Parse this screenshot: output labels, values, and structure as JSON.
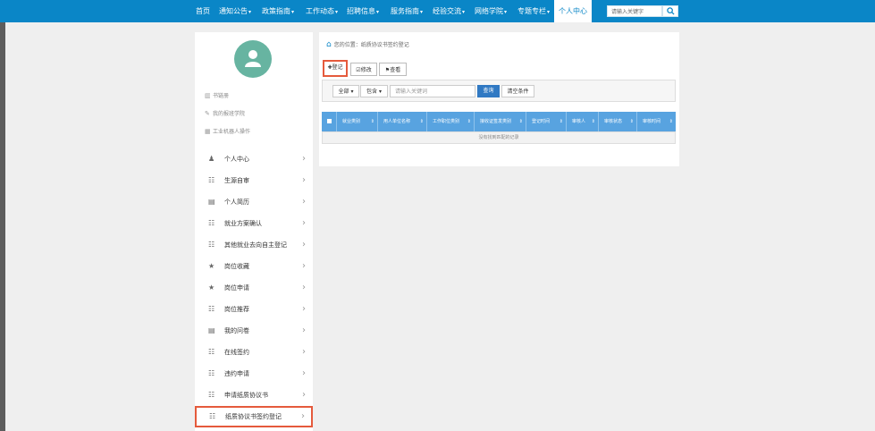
{
  "topnav": {
    "items": [
      "首页",
      "通知公告",
      "政策指南",
      "工作动态",
      "招聘信息",
      "服务指南",
      "经验交流",
      "网络学院",
      "专题专栏",
      "个人中心"
    ],
    "active": "个人中心",
    "search_placeholder": "请输入关键字"
  },
  "sidebar": {
    "quick_links": [
      "书链册",
      "我的报班学院",
      "工业机器人操作"
    ],
    "menu": [
      {
        "label": "个人中心",
        "icon": "person-icon"
      },
      {
        "label": "生源自审",
        "icon": "list-icon"
      },
      {
        "label": "个人简历",
        "icon": "doc-icon"
      },
      {
        "label": "就业方案确认",
        "icon": "list-icon"
      },
      {
        "label": "其他就业去向自主登记",
        "icon": "list-icon"
      },
      {
        "label": "岗位收藏",
        "icon": "star-icon"
      },
      {
        "label": "岗位申请",
        "icon": "star-icon"
      },
      {
        "label": "岗位推荐",
        "icon": "list-icon"
      },
      {
        "label": "我的问卷",
        "icon": "doc-icon"
      },
      {
        "label": "在线签约",
        "icon": "list-icon"
      },
      {
        "label": "违约申请",
        "icon": "list-icon"
      },
      {
        "label": "申请纸质协议书",
        "icon": "list-icon"
      },
      {
        "label": "纸质协议书签约登记",
        "icon": "list-icon"
      }
    ]
  },
  "main": {
    "breadcrumb": "您的位置：纸质协议书签约登记",
    "toolbar": {
      "register": "登记",
      "edit": "修改",
      "view": "查看"
    },
    "filters": {
      "all": "全部",
      "type": "包含",
      "keyword_placeholder": "请输入关键词",
      "query": "查询",
      "clear": "清空条件"
    },
    "table": {
      "columns": [
        "就业类别",
        "用人单位名称",
        "工作职位类别",
        "接收证签发类别",
        "登记时间",
        "审核人",
        "审核状态",
        "审核时间"
      ],
      "empty_text": "没有找到匹配的记录"
    }
  },
  "colors": {
    "brand": "#0a86c7",
    "highlight": "#e55a3c",
    "table_header": "#58a3e0",
    "avatar": "#67b4a1"
  }
}
